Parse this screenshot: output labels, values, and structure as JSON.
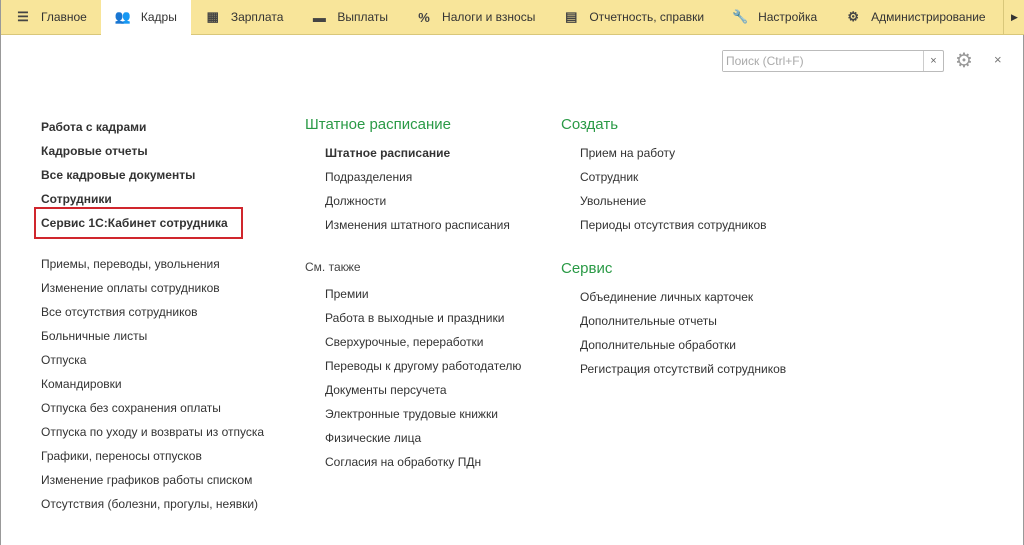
{
  "topbar": {
    "tabs": [
      {
        "label": "Главное",
        "icon": "menu-icon",
        "glyph": "☰"
      },
      {
        "label": "Кадры",
        "icon": "users-icon",
        "glyph": "👥",
        "active": true
      },
      {
        "label": "Зарплата",
        "icon": "calculator-icon",
        "glyph": "▦"
      },
      {
        "label": "Выплаты",
        "icon": "card-icon",
        "glyph": "▬"
      },
      {
        "label": "Налоги и взносы",
        "icon": "percent-icon",
        "glyph": "%"
      },
      {
        "label": "Отчетность, справки",
        "icon": "reports-icon",
        "glyph": "▤"
      },
      {
        "label": "Настройка",
        "icon": "wrench-icon",
        "glyph": "🔧"
      },
      {
        "label": "Администрирование",
        "icon": "gear-icon",
        "glyph": "⚙"
      }
    ],
    "more": "▶"
  },
  "search": {
    "placeholder": "Поиск (Ctrl+F)",
    "value": ""
  },
  "accent": "#2a9a46",
  "highlight": "#d0262d",
  "col1": {
    "main": [
      "Работа с кадрами",
      "Кадровые отчеты",
      "Все кадровые документы",
      "Сотрудники",
      "Сервис 1С:Кабинет сотрудника"
    ],
    "items": [
      "Приемы, переводы, увольнения",
      "Изменение оплаты сотрудников",
      "Все отсутствия сотрудников",
      "Больничные листы",
      "Отпуска",
      "Командировки",
      "Отпуска без сохранения оплаты",
      "Отпуска по уходу и возвраты из отпуска",
      "Графики, переносы отпусков",
      "Изменение графиков работы списком",
      "Отсутствия (болезни, прогулы, неявки)"
    ]
  },
  "col2": {
    "header": "Штатное расписание",
    "items": [
      "Штатное расписание",
      "Подразделения",
      "Должности",
      "Изменения штатного расписания"
    ],
    "see_also": "См. также",
    "see_items": [
      "Премии",
      "Работа в выходные и праздники",
      "Сверхурочные, переработки",
      "Переводы к другому работодателю",
      "Документы персучета",
      "Электронные трудовые книжки",
      "Физические лица",
      "Согласия на обработку ПДн"
    ]
  },
  "col3": {
    "header": "Создать",
    "items": [
      "Прием на работу",
      "Сотрудник",
      "Увольнение",
      "Периоды отсутствия сотрудников"
    ],
    "header2": "Сервис",
    "items2": [
      "Объединение личных карточек",
      "Дополнительные отчеты",
      "Дополнительные обработки",
      "Регистрация отсутствий сотрудников"
    ]
  }
}
